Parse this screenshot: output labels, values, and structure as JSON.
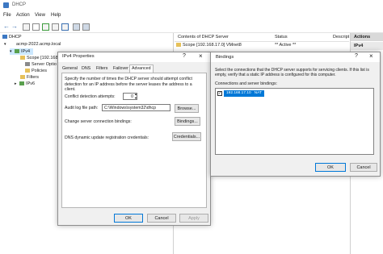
{
  "window": {
    "title": "DHCP"
  },
  "menu": [
    "File",
    "Action",
    "View",
    "Help"
  ],
  "toolbar": [
    "back-icon",
    "forward-icon",
    "console-icon",
    "properties-icon",
    "refresh-icon",
    "export-icon",
    "help-icon",
    "server-icon",
    "monitor-icon"
  ],
  "tree": {
    "root": "DHCP",
    "server": "acmp-2022.acmp.local",
    "ipv4": "IPv4",
    "scope": "Scope [192.168.17.",
    "server_options": "Server Optio",
    "policies": "Policies",
    "filters": "Filters",
    "ipv6": "IPv6"
  },
  "list": {
    "columns": [
      "Contents of DHCP Server",
      "Status",
      "Descript"
    ],
    "rows": [
      {
        "name": "Scope [192.168.17.0] VMnet8",
        "status": "** Active **",
        "desc": ""
      }
    ]
  },
  "actions": {
    "header": "Actions",
    "item": "IPv4"
  },
  "ipv4_dialog": {
    "title": "IPv4 Properties",
    "help_btn": "?",
    "close_btn": "×",
    "tabs": [
      "General",
      "DNS",
      "Filters",
      "Failover",
      "Advanced"
    ],
    "active_tab": "Advanced",
    "description": "Specify the number of times the DHCP server should attempt conflict detection for an IP address before the server leases the address to a client.",
    "conflict_label": "Conflict detection attempts:",
    "conflict_value": "0",
    "audit_label": "Audit log file path:",
    "audit_value": "C:\\Windows\\system32\\dhcp",
    "browse_btn": "Browse...",
    "bindings_label": "Change server connection bindings:",
    "bindings_btn": "Bindings...",
    "dns_label": "DNS dynamic update registration credentials:",
    "credentials_btn": "Credentials...",
    "ok": "OK",
    "cancel": "Cancel",
    "apply": "Apply"
  },
  "bindings_dialog": {
    "title": "Bindings",
    "help_btn": "?",
    "close_btn": "×",
    "description": "Select the connections that the DHCP server supports for servicing clients. If this list is empty, verify that a static IP address is configured for this computer.",
    "list_label": "Connections and server bindings:",
    "binding": "192.168.17.10   NAT",
    "binding_checked": true,
    "ok": "OK",
    "cancel": "Cancel"
  },
  "colors": {
    "accent": "#0078d7",
    "selection": "#cce8ff",
    "actions_header": "#d9d9d9",
    "dialog_bg": "#f0f0f0"
  }
}
